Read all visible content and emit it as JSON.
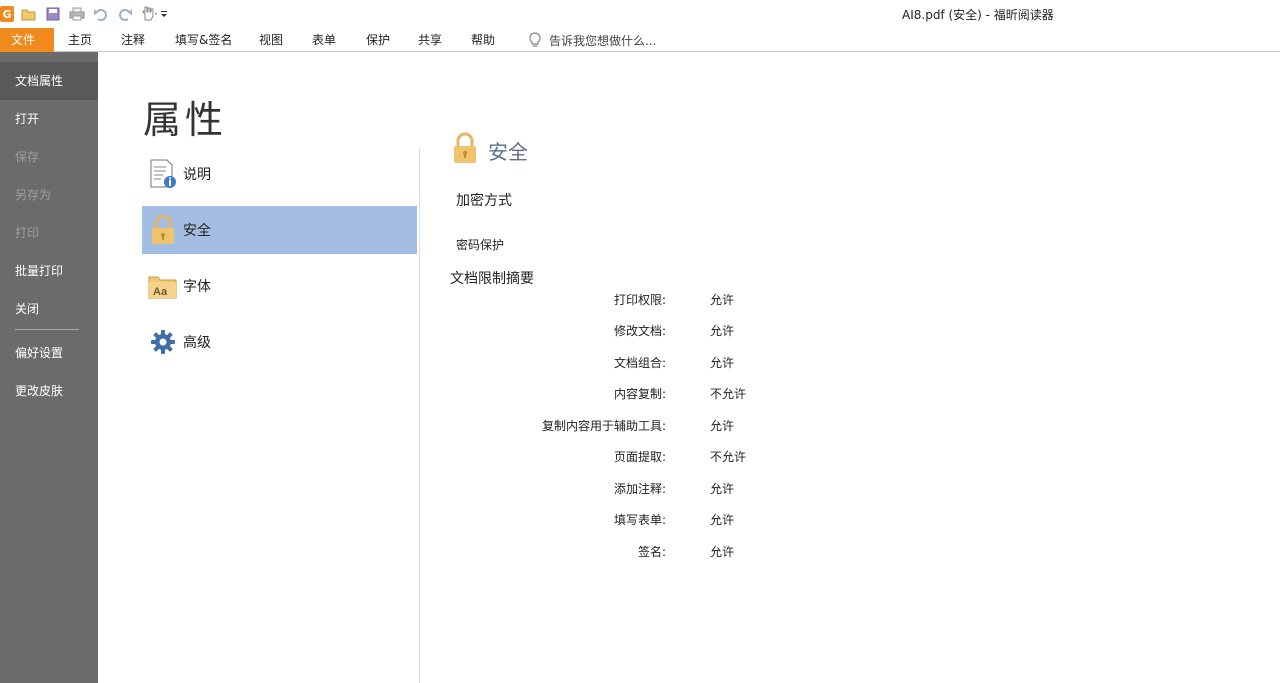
{
  "window": {
    "title": "AI8.pdf (安全) - 福昕阅读器",
    "quick_access": [
      "open-icon",
      "save-icon",
      "print-icon",
      "undo-icon",
      "redo-icon",
      "hand-tool-icon",
      "customize-dropdown-icon"
    ]
  },
  "ribbon": {
    "tabs": [
      "文件",
      "主页",
      "注释",
      "填写&签名",
      "视图",
      "表单",
      "保护",
      "共享",
      "帮助"
    ],
    "tell_me": "告诉我您想做什么..."
  },
  "nav": {
    "items": [
      {
        "label": "文档属性",
        "state": "active"
      },
      {
        "label": "打开",
        "state": "normal"
      },
      {
        "label": "保存",
        "state": "disabled"
      },
      {
        "label": "另存为",
        "state": "disabled"
      },
      {
        "label": "打印",
        "state": "disabled"
      },
      {
        "label": "批量打印",
        "state": "normal"
      },
      {
        "label": "关闭",
        "state": "normal"
      },
      {
        "label": "偏好设置",
        "state": "normal"
      },
      {
        "label": "更改皮肤",
        "state": "normal"
      }
    ]
  },
  "properties": {
    "title": "属性",
    "categories": [
      {
        "label": "说明",
        "icon": "document-info-icon"
      },
      {
        "label": "安全",
        "icon": "lock-icon",
        "selected": true
      },
      {
        "label": "字体",
        "icon": "font-folder-icon"
      },
      {
        "label": "高级",
        "icon": "gear-icon"
      }
    ]
  },
  "security": {
    "title": "安全",
    "encryption_label": "加密方式",
    "encryption_value": "密码保护",
    "summary_heading": "文档限制摘要",
    "permissions": [
      {
        "key": "打印权限:",
        "value": "允许"
      },
      {
        "key": "修改文档:",
        "value": "允许"
      },
      {
        "key": "文档组合:",
        "value": "允许"
      },
      {
        "key": "内容复制:",
        "value": "不允许"
      },
      {
        "key": "复制内容用于辅助工具:",
        "value": "允许"
      },
      {
        "key": "页面提取:",
        "value": "不允许"
      },
      {
        "key": "添加注释:",
        "value": "允许"
      },
      {
        "key": "填写表单:",
        "value": "允许"
      },
      {
        "key": "签名:",
        "value": "允许"
      }
    ]
  },
  "colors": {
    "accent": "#f08a1c",
    "nav_bg": "#6b6b6b",
    "selected_bg": "#a3bde3",
    "section_title": "#5a6f8e"
  }
}
